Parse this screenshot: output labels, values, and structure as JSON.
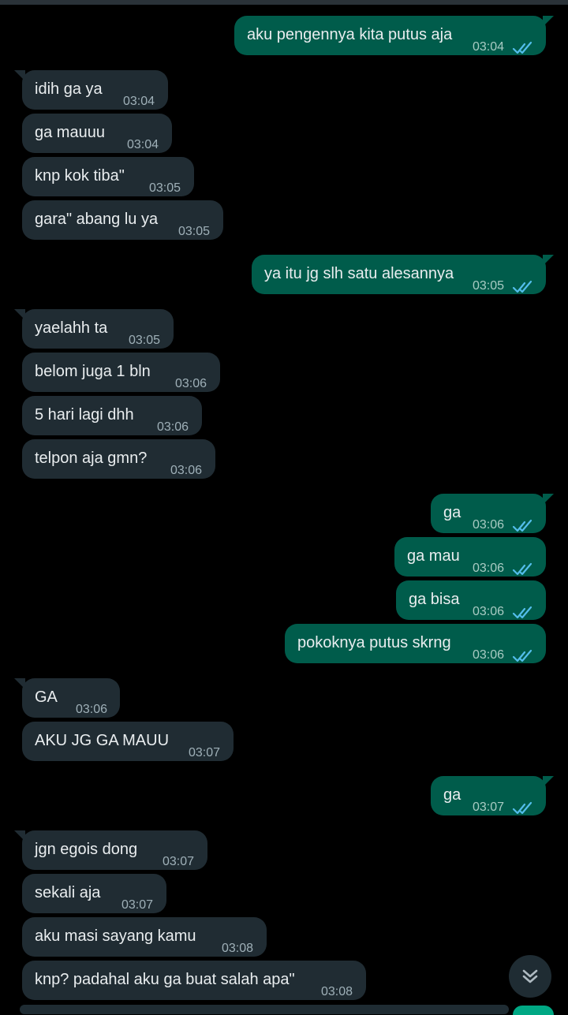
{
  "messages": [
    {
      "dir": "out",
      "text": "aku pengennya kita putus aja",
      "time": "03:04",
      "read": true
    },
    {
      "dir": "in",
      "text": "idih ga ya",
      "time": "03:04"
    },
    {
      "dir": "in",
      "text": "ga mauuu",
      "time": "03:04"
    },
    {
      "dir": "in",
      "text": "knp kok tiba\"",
      "time": "03:05"
    },
    {
      "dir": "in",
      "text": "gara\" abang lu ya",
      "time": "03:05"
    },
    {
      "dir": "out",
      "text": "ya itu jg slh satu alesannya",
      "time": "03:05",
      "read": true
    },
    {
      "dir": "in",
      "text": "yaelahh ta",
      "time": "03:05"
    },
    {
      "dir": "in",
      "text": "belom juga 1 bln",
      "time": "03:06"
    },
    {
      "dir": "in",
      "text": "5 hari lagi dhh",
      "time": "03:06"
    },
    {
      "dir": "in",
      "text": "telpon aja gmn?",
      "time": "03:06"
    },
    {
      "dir": "out",
      "text": "ga",
      "time": "03:06",
      "read": true
    },
    {
      "dir": "out",
      "text": "ga mau",
      "time": "03:06",
      "read": true
    },
    {
      "dir": "out",
      "text": "ga bisa",
      "time": "03:06",
      "read": true
    },
    {
      "dir": "out",
      "text": "pokoknya putus skrng",
      "time": "03:06",
      "read": true
    },
    {
      "dir": "in",
      "text": "GA",
      "time": "03:06"
    },
    {
      "dir": "in",
      "text": "AKU JG GA MAUU",
      "time": "03:07"
    },
    {
      "dir": "out",
      "text": "ga",
      "time": "03:07",
      "read": true
    },
    {
      "dir": "in",
      "text": "jgn egois dong",
      "time": "03:07"
    },
    {
      "dir": "in",
      "text": "sekali aja",
      "time": "03:07"
    },
    {
      "dir": "in",
      "text": "aku masi sayang kamu",
      "time": "03:08"
    },
    {
      "dir": "in",
      "text": "knp? padahal aku ga buat salah apa\"",
      "time": "03:08"
    }
  ],
  "icons": {
    "read_receipt": "double-check-icon",
    "scroll_down": "double-chevron-down-icon"
  },
  "colors": {
    "background": "#000000",
    "incoming_bubble": "#202c33",
    "outgoing_bubble": "#005c4b",
    "read_tick": "#53bdeb"
  }
}
